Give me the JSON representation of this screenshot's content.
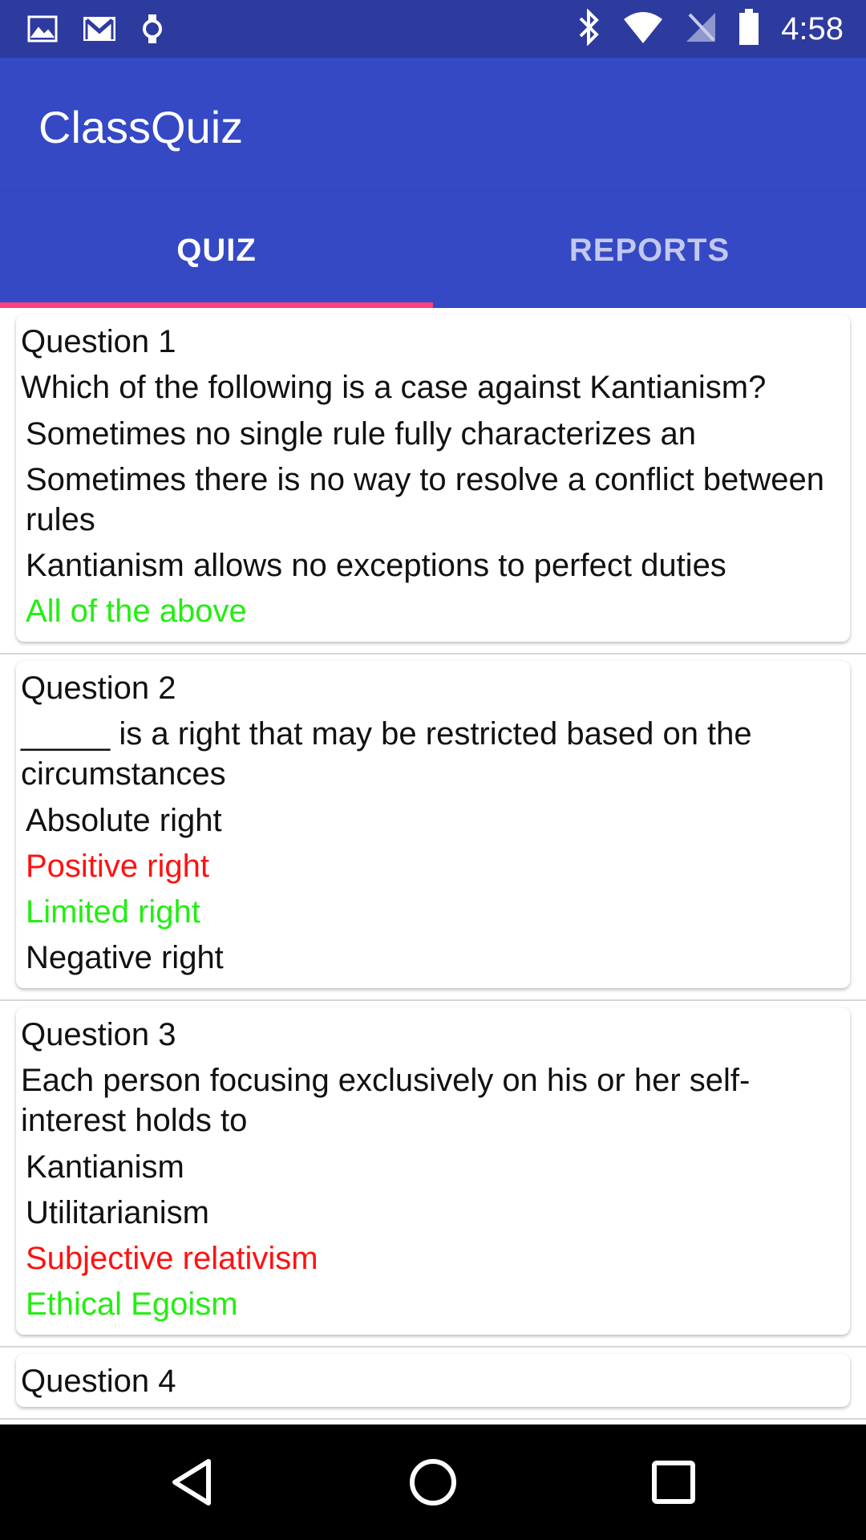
{
  "status_bar": {
    "left_icons": [
      "image-icon",
      "gmail-icon",
      "watch-icon"
    ],
    "right_icons": [
      "bluetooth-icon",
      "wifi-icon",
      "no-signal-icon",
      "battery-icon"
    ],
    "time": "4:58"
  },
  "app_bar": {
    "title": "ClassQuiz"
  },
  "tabs": [
    {
      "label": "QUIZ",
      "selected": true
    },
    {
      "label": "REPORTS",
      "selected": false
    }
  ],
  "colors": {
    "status_bar": "#2d3a9e",
    "app_bar": "#3549c4",
    "indicator": "#ff4081",
    "correct": "#22ee11",
    "wrong": "#ff1111"
  },
  "questions": [
    {
      "title": "Question 1",
      "text": "Which of the following is a case against Kantianism?",
      "options": [
        {
          "label": "Sometimes no single rule fully characterizes an",
          "state": "normal"
        },
        {
          "label": "Sometimes there is no way to resolve a conflict between rules",
          "state": "normal"
        },
        {
          "label": "Kantianism allows no exceptions to perfect duties",
          "state": "normal"
        },
        {
          "label": "All of the above",
          "state": "correct"
        }
      ]
    },
    {
      "title": "Question 2",
      "text": "_____ is a right that may be restricted based on the circumstances",
      "options": [
        {
          "label": "Absolute right",
          "state": "normal"
        },
        {
          "label": "Positive right",
          "state": "wrong"
        },
        {
          "label": "Limited right",
          "state": "correct"
        },
        {
          "label": "Negative right",
          "state": "normal"
        }
      ]
    },
    {
      "title": "Question 3",
      "text": "Each person focusing exclusively on his or her self-interest holds to",
      "options": [
        {
          "label": "Kantianism",
          "state": "normal"
        },
        {
          "label": "Utilitarianism",
          "state": "normal"
        },
        {
          "label": "Subjective relativism",
          "state": "wrong"
        },
        {
          "label": "Ethical Egoism",
          "state": "correct"
        }
      ]
    },
    {
      "title": "Question 4",
      "text": "",
      "options": []
    }
  ],
  "nav_bar": {
    "buttons": [
      "back-icon",
      "home-icon",
      "recents-icon"
    ]
  }
}
